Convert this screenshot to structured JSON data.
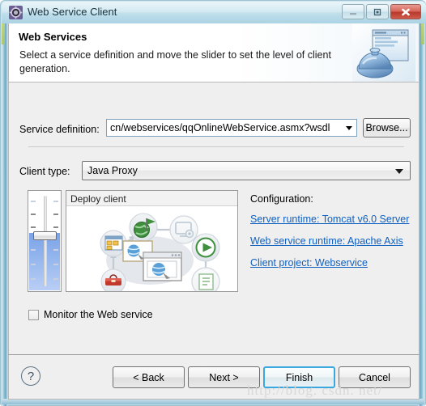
{
  "window": {
    "title": "Web Service Client",
    "icon": "gear-app-icon",
    "controls": {
      "minimize": "–",
      "maximize": "□",
      "close": "✕"
    }
  },
  "header": {
    "title": "Web Services",
    "description": "Select a service definition and move the slider to set the level of client generation.",
    "image": "web-service-banner-icon"
  },
  "form": {
    "service_definition": {
      "label": "Service definition:",
      "value": "cn/webservices/qqOnlineWebService.asmx?wsdl",
      "browse_label": "Browse..."
    },
    "client_type": {
      "label": "Client type:",
      "value": "Java Proxy"
    }
  },
  "slider": {
    "name": "client-generation-slider",
    "position_percent": 45
  },
  "diagram": {
    "title": "Deploy client",
    "nodes": [
      "client-assemble-icon",
      "deploy-globe-icon",
      "install-monitor-icon",
      "start-play-icon",
      "test-list-icon",
      "develop-toolbox-icon",
      "client-browser-icon"
    ]
  },
  "configuration": {
    "title": "Configuration:",
    "links": [
      {
        "label": "Server runtime: Tomcat v6.0 Server",
        "name": "server-runtime-link"
      },
      {
        "label": "Web service runtime: Apache Axis",
        "name": "web-service-runtime-link"
      },
      {
        "label": "Client project: Webservice",
        "name": "client-project-link"
      }
    ]
  },
  "monitor": {
    "label": "Monitor the Web service",
    "checked": false
  },
  "buttons": {
    "help": "?",
    "back": "< Back",
    "next": "Next >",
    "finish": "Finish",
    "cancel": "Cancel"
  },
  "watermark": "http://blog. csdn. net/",
  "colors": {
    "link": "#1060c0",
    "accent": "#3aa8df",
    "slider_fill": "#7ba3e8",
    "titlebar": "#bfdfeb",
    "body": "#efefef"
  }
}
